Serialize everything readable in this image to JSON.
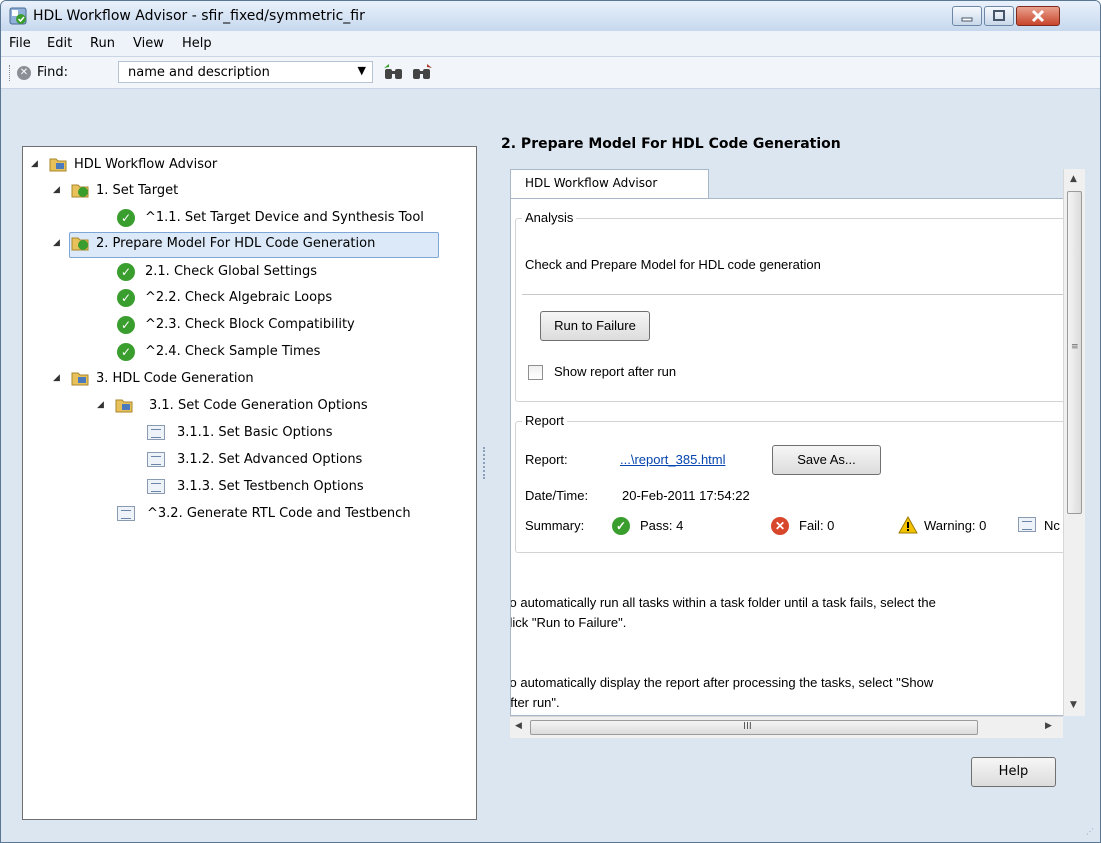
{
  "window": {
    "title": "HDL Workflow Advisor - sfir_fixed/symmetric_fir"
  },
  "menu": [
    "File",
    "Edit",
    "Run",
    "View",
    "Help"
  ],
  "toolbar": {
    "find_label": "Find:",
    "find_value": "name and description"
  },
  "tree": {
    "root": "HDL Workflow Advisor",
    "items": [
      {
        "label": "1. Set Target"
      },
      {
        "label": "^1.1. Set Target Device and Synthesis Tool"
      },
      {
        "label": "2. Prepare Model For HDL Code Generation"
      },
      {
        "label": "2.1. Check Global Settings"
      },
      {
        "label": "^2.2. Check Algebraic Loops"
      },
      {
        "label": "^2.3. Check Block Compatibility"
      },
      {
        "label": "^2.4. Check Sample Times"
      },
      {
        "label": "3. HDL Code Generation"
      },
      {
        "label": "3.1. Set Code Generation Options"
      },
      {
        "label": "3.1.1. Set Basic Options"
      },
      {
        "label": "3.1.2. Set Advanced Options"
      },
      {
        "label": "3.1.3. Set Testbench Options"
      },
      {
        "label": "^3.2. Generate RTL Code and Testbench"
      }
    ]
  },
  "right": {
    "header": "2. Prepare Model For HDL Code Generation",
    "tab": "HDL Workflow Advisor",
    "analysis": {
      "legend": "Analysis",
      "description": "Check and Prepare Model for HDL code generation",
      "run_button": "Run to Failure",
      "show_report_label": "Show report after run"
    },
    "report": {
      "legend": "Report",
      "report_label": "Report:",
      "report_link": "...\\report_385.html",
      "save_as": "Save As...",
      "datetime_label": "Date/Time:",
      "datetime_value": "20-Feb-2011 17:54:22",
      "summary_label": "Summary:",
      "pass": "Pass: 4",
      "fail": "Fail: 0",
      "warning": "Warning: 0",
      "not_run": "Nc"
    },
    "info1_line1": " To automatically run all tasks within a task folder until a task fails, select the",
    "info1_line2": "click \"Run to Failure\".",
    "info2_line1": " To automatically display the report after processing the tasks, select \"Show",
    "info2_line2": "after run\".",
    "hscroll_grip": "III",
    "help_button": "Help"
  },
  "colors": {
    "pass": "#3a9e2f",
    "fail": "#d8462c",
    "warning": "#f2c200",
    "link": "#0645ad"
  }
}
